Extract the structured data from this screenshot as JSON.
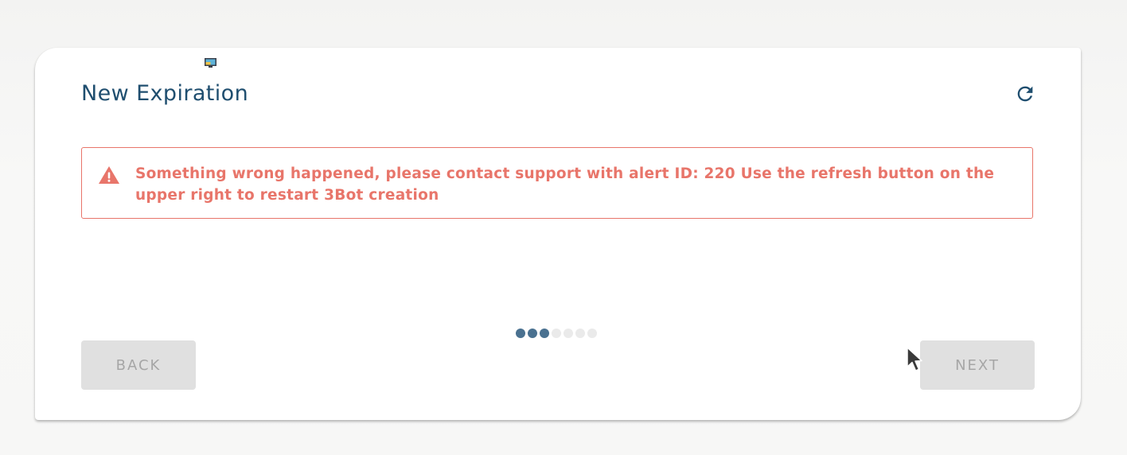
{
  "header": {
    "title": "New Expiration"
  },
  "alert": {
    "message": "Something wrong happened, please contact support with alert ID: 220 Use the refresh button on the upper right to restart 3Bot creation",
    "color": "#e8756a"
  },
  "stepper": {
    "total_steps": 7,
    "completed_steps": 3,
    "active_color": "#4a7190",
    "inactive_color": "#eaeaea"
  },
  "navigation": {
    "back_label": "BACK",
    "next_label": "NEXT"
  },
  "icons": {
    "refresh": "refresh-icon",
    "alert": "warning-icon",
    "logo": "app-logo-icon",
    "cursor": "mouse-cursor-icon"
  },
  "colors": {
    "title": "#1f4e6f",
    "button_bg": "#e0e0e0",
    "button_text": "#a6a6a6"
  }
}
